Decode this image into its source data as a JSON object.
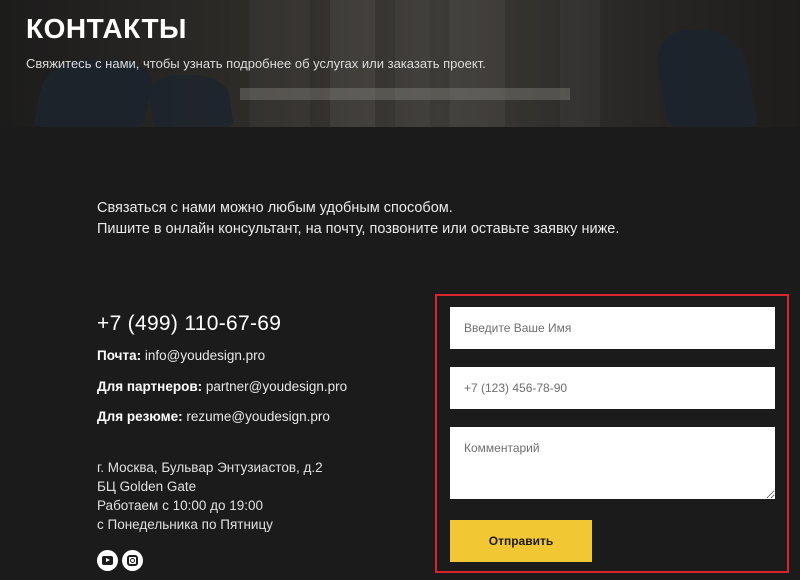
{
  "hero": {
    "title": "КОНТАКТЫ",
    "subtitle": "Свяжитесь с нами, чтобы узнать подробнее об услугах или заказать проект."
  },
  "intro": {
    "line1": "Связаться с нами можно любым удобным способом.",
    "line2": "Пишите в онлайн консультант, на почту, позвоните или оставьте заявку ниже."
  },
  "contacts": {
    "phone": "+7 (499) 110-67-69",
    "mail_label": "Почта:",
    "mail": "info@youdesign.pro",
    "partners_label": "Для партнеров:",
    "partners": "partner@youdesign.pro",
    "resume_label": "Для резюме:",
    "resume": "rezume@youdesign.pro"
  },
  "address": {
    "line1": "г. Москва, Бульвар Энтузиастов, д.2",
    "line2": "БЦ Golden Gate",
    "line3": "Работаем с 10:00 до 19:00",
    "line4": "с Понедельника по Пятницу"
  },
  "social": {
    "youtube_icon": "youtube-icon",
    "instagram_icon": "instagram-icon"
  },
  "form": {
    "name_placeholder": "Введите Ваше Имя",
    "phone_placeholder": "+7 (123) 456-78-90",
    "comment_placeholder": "Комментарий",
    "submit_label": "Отправить",
    "accent_color": "#f2c734",
    "highlight_color": "#d9262e"
  }
}
